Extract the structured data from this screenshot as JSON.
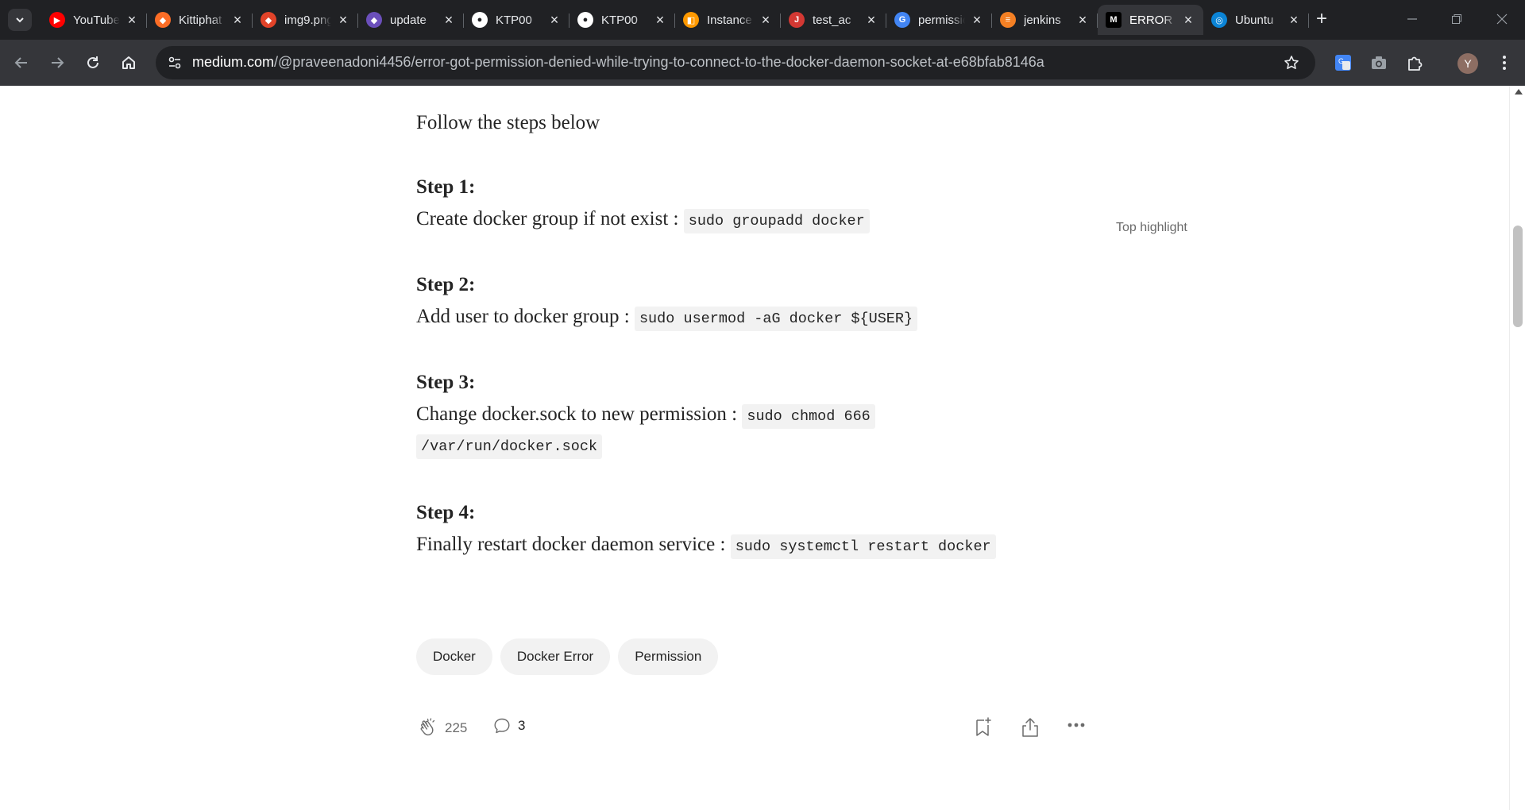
{
  "browser": {
    "tabs": [
      {
        "title": "YouTube",
        "icon": "youtube-icon",
        "color": "#ff0000"
      },
      {
        "title": "Kittiphat",
        "icon": "gitlab-icon",
        "color": "#fc6d26"
      },
      {
        "title": "img9.png",
        "icon": "gitlab-icon",
        "color": "#e24329"
      },
      {
        "title": "update",
        "icon": "gitlab-project-icon",
        "color": "#6b4fbb"
      },
      {
        "title": "KTP00",
        "icon": "github-icon",
        "color": "#ffffff"
      },
      {
        "title": "KTP00",
        "icon": "github-icon",
        "color": "#ffffff"
      },
      {
        "title": "Instance",
        "icon": "aws-icon",
        "color": "#ff9900"
      },
      {
        "title": "test_ac",
        "icon": "jenkins-icon",
        "color": "#d33833"
      },
      {
        "title": "permission",
        "icon": "google-icon",
        "color": "#4285f4"
      },
      {
        "title": "jenkins",
        "icon": "stackoverflow-icon",
        "color": "#f48024"
      },
      {
        "title": "ERROR",
        "icon": "medium-icon",
        "color": "#000000",
        "active": true
      },
      {
        "title": "Ubuntu",
        "icon": "ubuntu-icon",
        "color": "#0b84d6"
      }
    ],
    "url_host": "medium.com",
    "url_path": "/@praveenadoni4456/error-got-permission-denied-while-trying-to-connect-to-the-docker-daemon-socket-at-e68bfab8146a",
    "avatar_letter": "Y"
  },
  "article": {
    "lead": "Follow the steps below",
    "steps": [
      {
        "title": "Step 1:",
        "text": "Create docker group if not exist : ",
        "code": "sudo groupadd docker"
      },
      {
        "title": "Step 2:",
        "text": "Add user to docker group : ",
        "code": "sudo usermod -aG docker ${USER}"
      },
      {
        "title": "Step 3:",
        "text": "Change docker.sock to new permission : ",
        "code": "sudo chmod 666",
        "code_cont": "/var/run/docker.sock"
      },
      {
        "title": "Step 4:",
        "text": "Finally restart docker daemon service : ",
        "code": "sudo systemctl restart docker"
      }
    ],
    "top_highlight": "Top highlight",
    "tags": [
      "Docker",
      "Docker Error",
      "Permission"
    ],
    "claps": "225",
    "responses": "3"
  }
}
